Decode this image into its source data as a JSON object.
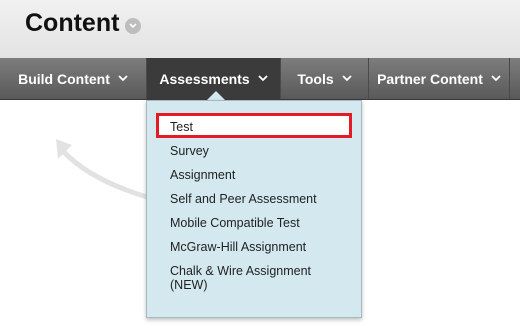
{
  "page": {
    "title": "Content"
  },
  "nav": {
    "items": [
      {
        "label": "Build Content"
      },
      {
        "label": "Assessments"
      },
      {
        "label": "Tools"
      },
      {
        "label": "Partner Content"
      }
    ]
  },
  "menu": {
    "items": [
      {
        "label": "Test"
      },
      {
        "label": "Survey"
      },
      {
        "label": "Assignment"
      },
      {
        "label": "Self and Peer Assessment"
      },
      {
        "label": "Mobile Compatible Test"
      },
      {
        "label": "McGraw-Hill Assignment"
      },
      {
        "label": "Chalk & Wire Assignment"
      },
      {
        "label": "(NEW)"
      }
    ]
  },
  "colors": {
    "highlight": "#e21b24",
    "menu_bg": "#d3e9ef",
    "nav_bg": "#6a6a6a"
  }
}
